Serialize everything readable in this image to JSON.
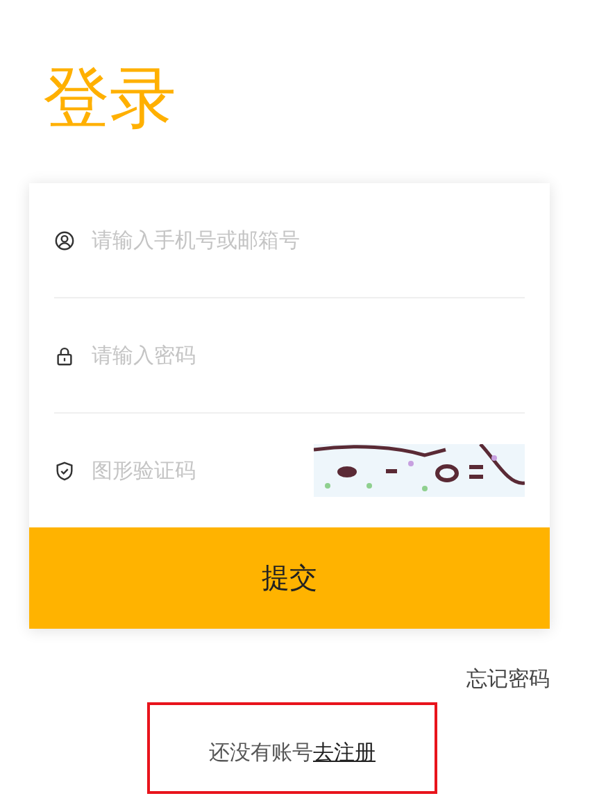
{
  "title": "登录",
  "fields": [
    {
      "kind": "account",
      "placeholder": "请输入手机号或邮箱号"
    },
    {
      "kind": "password",
      "placeholder": "请输入密码"
    },
    {
      "kind": "captcha",
      "placeholder": "图形验证码"
    }
  ],
  "submit": "提交",
  "forgot_link": "忘记密码",
  "register": {
    "prompt": "还没有账号",
    "link": "去注册",
    "highlighted": true
  }
}
